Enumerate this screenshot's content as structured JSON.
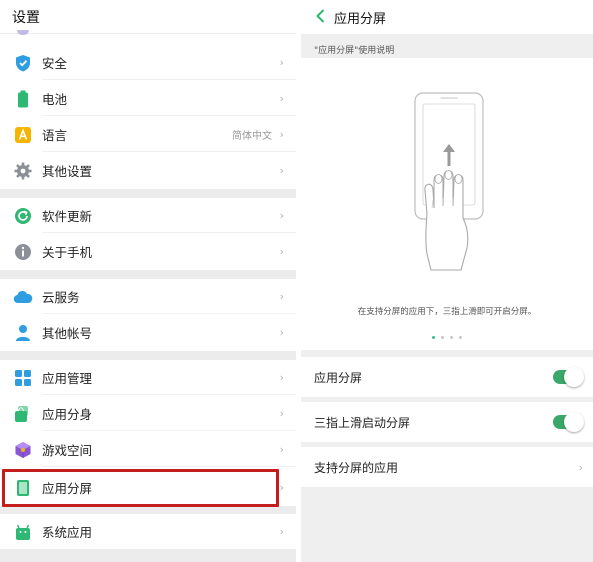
{
  "left": {
    "title": "设置",
    "items": [
      {
        "label": "安全",
        "icon": "shield-icon"
      },
      {
        "label": "电池",
        "icon": "battery-icon"
      },
      {
        "label": "语言",
        "icon": "language-icon",
        "value": "简体中文"
      },
      {
        "label": "其他设置",
        "icon": "gear-icon"
      },
      {
        "label": "软件更新",
        "icon": "refresh-icon"
      },
      {
        "label": "关于手机",
        "icon": "info-icon"
      },
      {
        "label": "云服务",
        "icon": "cloud-icon"
      },
      {
        "label": "其他帐号",
        "icon": "person-icon"
      },
      {
        "label": "应用管理",
        "icon": "apps-grid-icon"
      },
      {
        "label": "应用分身",
        "icon": "app-clone-icon"
      },
      {
        "label": "游戏空间",
        "icon": "game-cube-icon"
      },
      {
        "label": "应用分屏",
        "icon": "split-screen-icon"
      },
      {
        "label": "系统应用",
        "icon": "android-icon"
      }
    ]
  },
  "right": {
    "title": "应用分屏",
    "section_label": "\"应用分屏\"使用说明",
    "caption": "在支持分屏的应用下，三指上滑即可开启分屏。",
    "rows": [
      {
        "label": "应用分屏",
        "type": "toggle",
        "on": true
      },
      {
        "label": "三指上滑启动分屏",
        "type": "toggle",
        "on": true
      },
      {
        "label": "支持分屏的应用",
        "type": "link"
      }
    ],
    "pager": {
      "count": 4,
      "active": 0
    }
  },
  "colors": {
    "accent_green": "#3aa868",
    "highlight_red": "#c41d1d",
    "separator": "#ececec"
  }
}
